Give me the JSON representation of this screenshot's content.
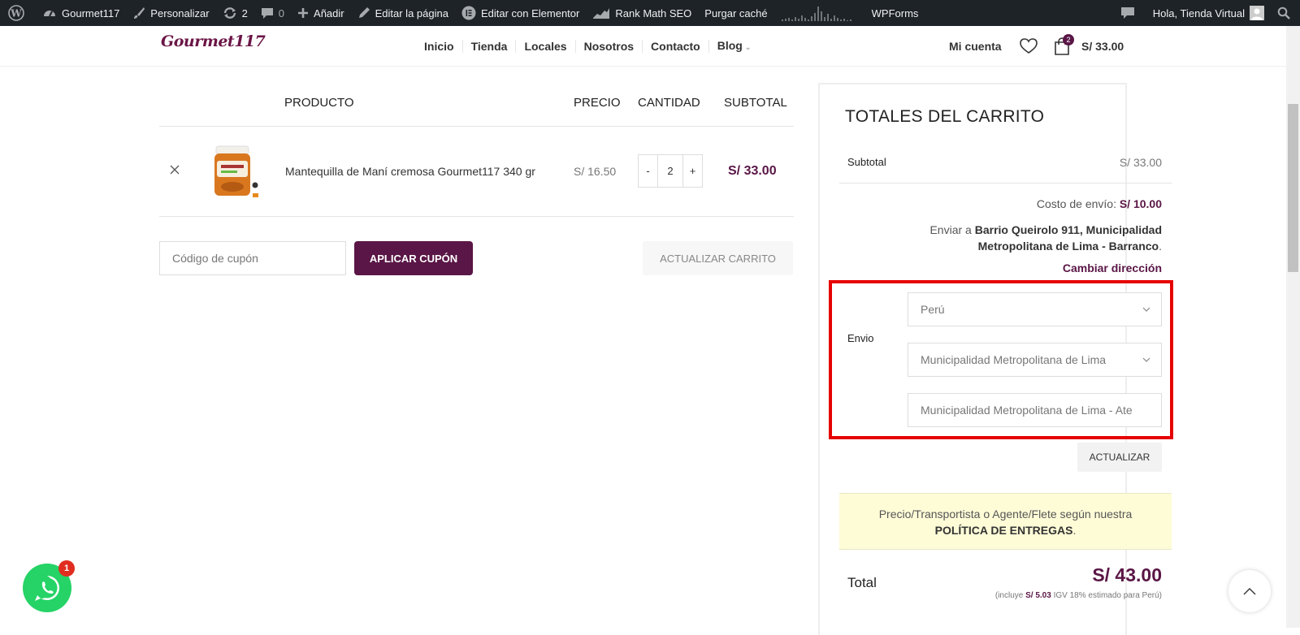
{
  "admin_bar": {
    "site": "Gourmet117",
    "customize": "Personalizar",
    "updates": "2",
    "comments": "0",
    "add_new": "Añadir",
    "edit_page": "Editar la página",
    "elementor": "Editar con Elementor",
    "rank_math": "Rank Math SEO",
    "purge_cache": "Purgar caché",
    "wpforms": "WPForms",
    "greeting": "Hola, Tienda Virtual"
  },
  "header": {
    "logo": "Gourmet117",
    "nav": [
      "Inicio",
      "Tienda",
      "Locales",
      "Nosotros",
      "Contacto",
      "Blog"
    ],
    "account": "Mi cuenta",
    "cart_count": "2",
    "cart_total": "S/ 33.00"
  },
  "cart_table": {
    "headers": {
      "product": "PRODUCTO",
      "price": "PRECIO",
      "quantity": "CANTIDAD",
      "subtotal": "SUBTOTAL"
    },
    "rows": [
      {
        "name": "Mantequilla de Maní cremosa Gourmet117 340 gr",
        "price": "S/ 16.50",
        "qty": "2",
        "subtotal": "S/ 33.00",
        "minus": "-",
        "plus": "+"
      }
    ]
  },
  "coupon": {
    "placeholder": "Código de cupón",
    "apply": "APLICAR CUPÓN",
    "update": "ACTUALIZAR CARRITO"
  },
  "totals": {
    "title": "TOTALES DEL CARRITO",
    "subtotal_label": "Subtotal",
    "subtotal_value": "S/ 33.00",
    "shipping_cost_label": "Costo de envío:",
    "shipping_cost": "S/ 10.00",
    "ship_to_prefix": "Enviar a",
    "ship_to_line1": "Barrio Queirolo 911, Municipalidad",
    "ship_to_line2": "Metropolitana de Lima - Barranco",
    "change_address": "Cambiar dirección",
    "shipping_label": "Envio",
    "country": "Perú",
    "state": "Municipalidad Metropolitana de Lima",
    "city": "Municipalidad Metropolitana de Lima - Ate",
    "update_button": "ACTUALIZAR",
    "notice_line1": "Precio/Transportista o Agente/Flete según nuestra",
    "notice_link": "POLÍTICA DE ENTREGAS",
    "total_label": "Total",
    "total_value": "S/ 43.00",
    "tax_prefix": "(incluye",
    "tax_value": "S/ 5.03",
    "tax_suffix": "IGV 18% estimado para Perú)"
  },
  "whatsapp_badge": "1",
  "colors": {
    "accent": "#5a1646",
    "highlight": "#e60000",
    "admin_bar": "#1d2327",
    "notice_bg": "#fefcd7"
  }
}
